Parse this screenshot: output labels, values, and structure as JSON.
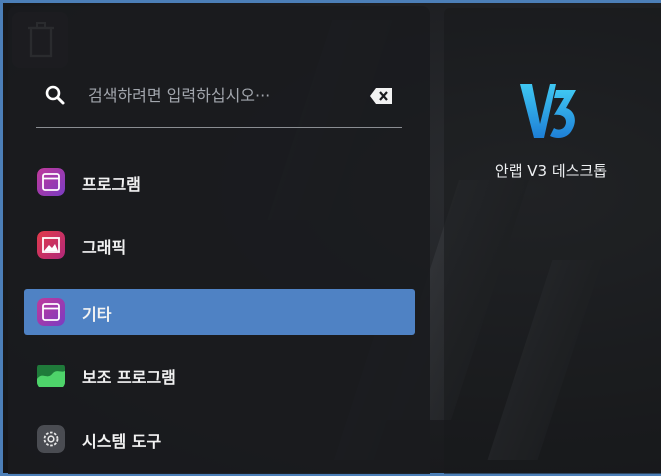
{
  "search": {
    "placeholder": "검색하려면 입력하십시오···"
  },
  "categories": [
    {
      "label": "프로그램",
      "icon": "window-icon",
      "active": false
    },
    {
      "label": "그래픽",
      "icon": "image-icon",
      "active": false
    },
    {
      "label": "기타",
      "icon": "window-icon",
      "active": true
    },
    {
      "label": "보조 프로그램",
      "icon": "accessories-icon",
      "active": false
    },
    {
      "label": "시스템 도구",
      "icon": "gear-icon",
      "active": false
    }
  ],
  "desktop": {
    "shortcut_label": "안랩 V3 데스크톱"
  },
  "colors": {
    "accent": "#4f82c4",
    "menu_bg": "#1a1b1e",
    "text": "#f2f2f2"
  }
}
